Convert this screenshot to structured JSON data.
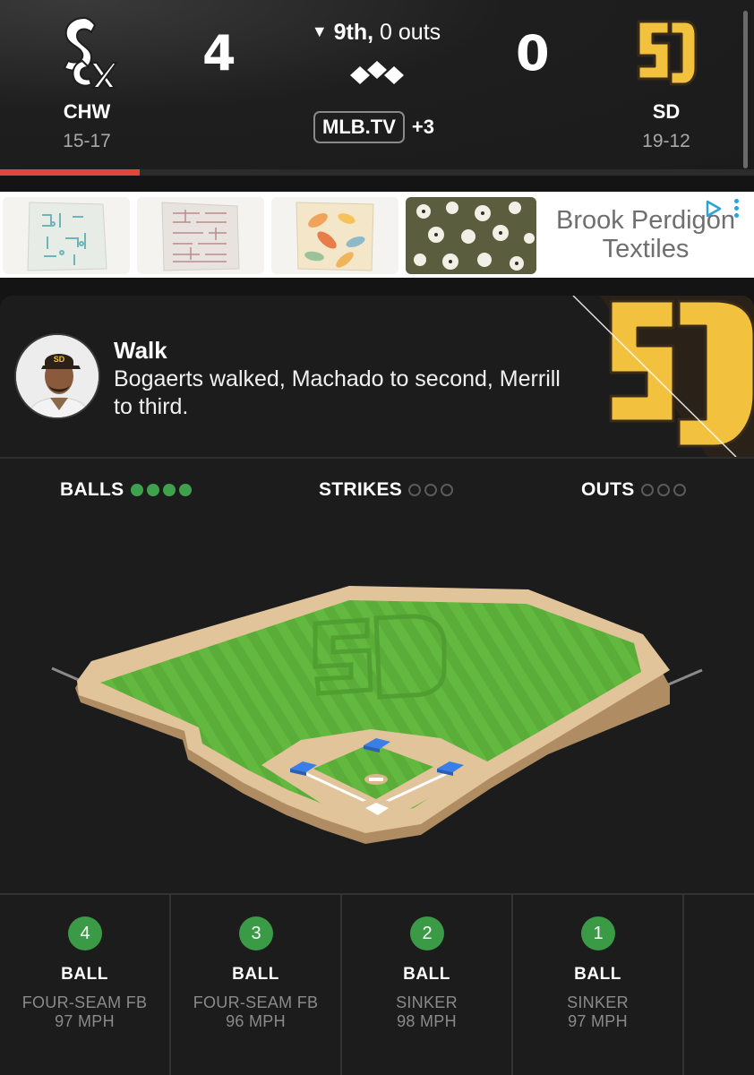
{
  "scoreboard": {
    "away": {
      "abbr": "CHW",
      "record": "15-17",
      "score": "4",
      "logo_icon": "white-sox-logo"
    },
    "home": {
      "abbr": "SD",
      "record": "19-12",
      "score": "0",
      "logo_icon": "padres-logo"
    },
    "inning_arrow": "▼",
    "inning": "9th,",
    "outs": "0 outs",
    "broadcast": "MLB.TV",
    "broadcast_more": "+3",
    "progress_fraction": 0.185
  },
  "ad": {
    "text_line1": "Brook Perdigon",
    "text_line2": "Textiles"
  },
  "play": {
    "title": "Walk",
    "description": "Bogaerts walked, Machado to second, Merrill to third."
  },
  "count": {
    "balls_label": "BALLS",
    "balls": 4,
    "strikes_label": "STRIKES",
    "strikes": 0,
    "outs_label": "OUTS",
    "outs": 0
  },
  "pitches": [
    {
      "number": "4",
      "result": "BALL",
      "type": "FOUR-SEAM FB",
      "speed": "97 MPH"
    },
    {
      "number": "3",
      "result": "BALL",
      "type": "FOUR-SEAM FB",
      "speed": "96 MPH"
    },
    {
      "number": "2",
      "result": "BALL",
      "type": "SINKER",
      "speed": "98 MPH"
    },
    {
      "number": "1",
      "result": "BALL",
      "type": "SINKER",
      "speed": "97 MPH"
    }
  ],
  "colors": {
    "accent_green": "#3fa14e",
    "progress_red": "#e0473a",
    "padres_gold": "#f2c13d",
    "field_green": "#5cae3a"
  }
}
